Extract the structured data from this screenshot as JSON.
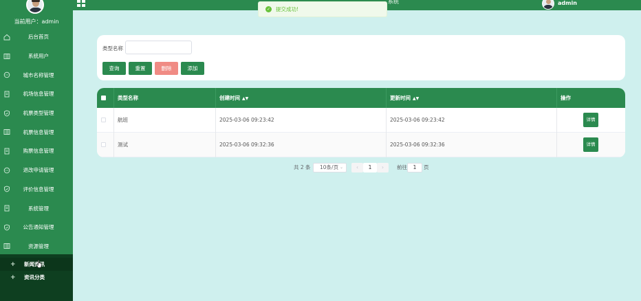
{
  "sidebar": {
    "current_user_label": "当前用户：",
    "current_user": "admin",
    "items": [
      {
        "label": "后台首页",
        "icon": "home-icon"
      },
      {
        "label": "系统用户",
        "icon": "columns-icon"
      },
      {
        "label": "城市名称管理",
        "icon": "chat-icon"
      },
      {
        "label": "机场信息管理",
        "icon": "document-icon"
      },
      {
        "label": "机票类型管理",
        "icon": "shield-icon"
      },
      {
        "label": "机票信息管理",
        "icon": "columns-icon"
      },
      {
        "label": "购票信息管理",
        "icon": "document-icon"
      },
      {
        "label": "退改申请管理",
        "icon": "chat-icon"
      },
      {
        "label": "评价信息管理",
        "icon": "shield-icon"
      },
      {
        "label": "系统管理",
        "icon": "document-icon"
      },
      {
        "label": "公告通知管理",
        "icon": "shield-icon"
      },
      {
        "label": "资源管理",
        "icon": "columns-icon"
      }
    ],
    "submenu": [
      {
        "label": "新闻资讯",
        "icon": "plus-icon"
      },
      {
        "label": "资讯分类",
        "icon": "plus-icon"
      }
    ]
  },
  "topbar": {
    "title": "系统",
    "user": "admin"
  },
  "toast": {
    "message": "提交成功!"
  },
  "search": {
    "label": "类型名称",
    "value": "",
    "buttons": {
      "query": "查询",
      "reset": "重置",
      "delete": "删除",
      "add": "添加"
    }
  },
  "table": {
    "columns": [
      "类型名称",
      "创建时间",
      "更新时间",
      "操作"
    ],
    "rows": [
      {
        "name": "航班",
        "created": "2025-03-06 09:23:42",
        "updated": "2025-03-06 09:23:42",
        "action": "详情"
      },
      {
        "name": "测试",
        "created": "2025-03-06 09:32:36",
        "updated": "2025-03-06 09:32:36",
        "action": "详情"
      }
    ]
  },
  "pagination": {
    "total_label": "共 2 条",
    "page_size": "10条/页",
    "current_page": "1",
    "goto_label": "前往",
    "goto_value": "1",
    "page_suffix": "页"
  },
  "colors": {
    "primary": "#2b8a4f",
    "background": "#cff0ee",
    "danger": "#f08b84",
    "submenu_bg": "#0e3f20",
    "success": "#67c23a"
  }
}
